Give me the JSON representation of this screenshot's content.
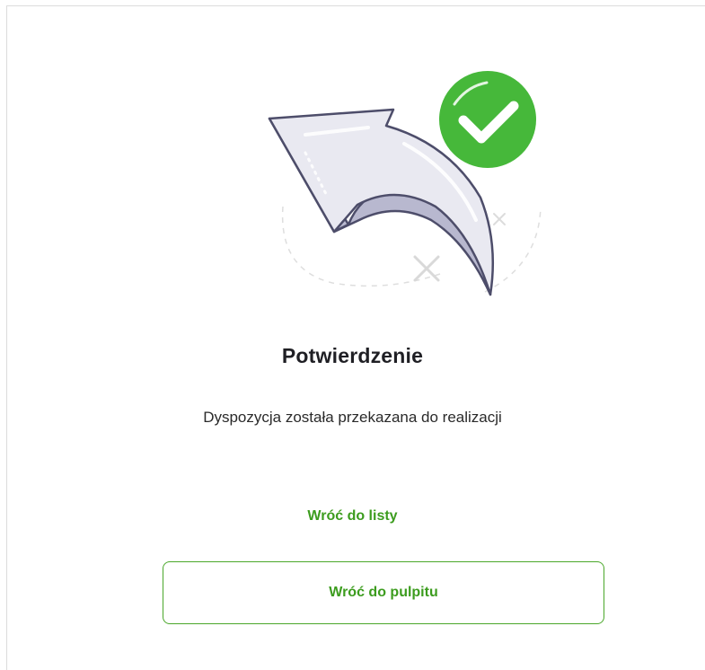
{
  "confirmation": {
    "title": "Potwierdzenie",
    "message": "Dyspozycja została przekazana do realizacji",
    "link_back_to_list": "Wróć do listy",
    "button_back_to_dashboard": "Wróć do pulpitu"
  },
  "icons": {
    "arrow": "return-arrow-icon",
    "success": "checkmark-circle-icon"
  },
  "colors": {
    "accent_green": "#3c9c1e",
    "success_circle": "#46b83a"
  }
}
